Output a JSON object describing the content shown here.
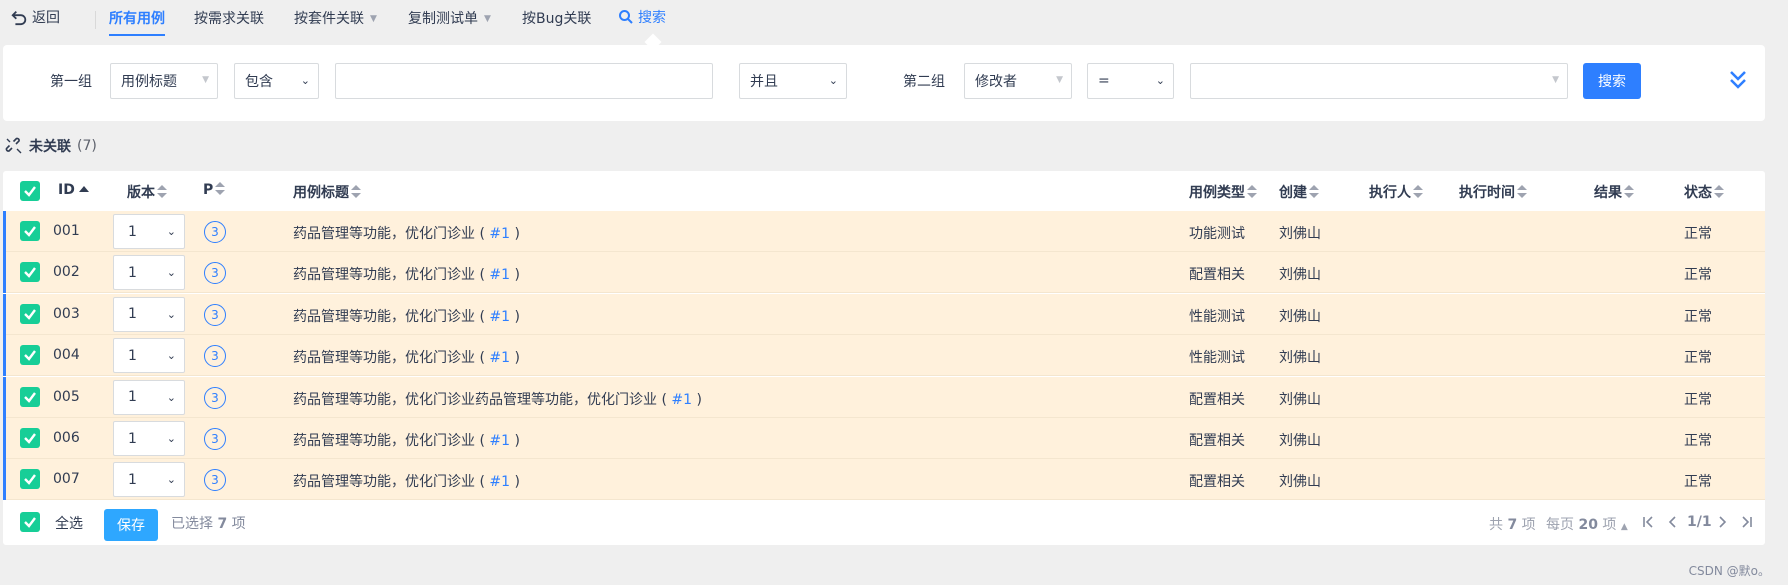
{
  "nav": {
    "back": "返回",
    "tabs": [
      {
        "label": "所有用例",
        "active": true
      },
      {
        "label": "按需求关联"
      },
      {
        "label": "按套件关联"
      },
      {
        "label": "复制测试单"
      },
      {
        "label": "按Bug关联"
      }
    ],
    "search": "搜索"
  },
  "search_panel": {
    "group1_label": "第一组",
    "group1_field": "用例标题",
    "group1_operator": "包含",
    "group1_value": "",
    "andor": "并且",
    "group2_label": "第二组",
    "group2_field": "修改者",
    "group2_operator": "=",
    "group2_value": "",
    "search_button": "搜索"
  },
  "section": {
    "title": "未关联",
    "count": "(7)"
  },
  "table": {
    "headers": {
      "id": "ID",
      "version": "版本",
      "pri": "P",
      "title": "用例标题",
      "type": "用例类型",
      "creator": "创建",
      "executor": "执行人",
      "exec_time": "执行时间",
      "result": "结果",
      "status": "状态"
    },
    "rows": [
      {
        "id": "001",
        "version": "1",
        "pri": "3",
        "title": "药品管理等功能，优化门诊业 (",
        "link": "#1",
        "close": ")",
        "type": "功能测试",
        "creator": "刘佛山",
        "status": "正常"
      },
      {
        "id": "002",
        "version": "1",
        "pri": "3",
        "title": "药品管理等功能，优化门诊业 (",
        "link": "#1",
        "close": ")",
        "type": "配置相关",
        "creator": "刘佛山",
        "status": "正常"
      },
      {
        "id": "003",
        "version": "1",
        "pri": "3",
        "title": "药品管理等功能，优化门诊业 (",
        "link": "#1",
        "close": ")",
        "type": "性能测试",
        "creator": "刘佛山",
        "status": "正常"
      },
      {
        "id": "004",
        "version": "1",
        "pri": "3",
        "title": "药品管理等功能，优化门诊业 (",
        "link": "#1",
        "close": ")",
        "type": "性能测试",
        "creator": "刘佛山",
        "status": "正常"
      },
      {
        "id": "005",
        "version": "1",
        "pri": "3",
        "title": "药品管理等功能，优化门诊业药品管理等功能，优化门诊业 (",
        "link": "#1",
        "close": ")",
        "type": "配置相关",
        "creator": "刘佛山",
        "status": "正常"
      },
      {
        "id": "006",
        "version": "1",
        "pri": "3",
        "title": "药品管理等功能，优化门诊业 (",
        "link": "#1",
        "close": ")",
        "type": "配置相关",
        "creator": "刘佛山",
        "status": "正常"
      },
      {
        "id": "007",
        "version": "1",
        "pri": "3",
        "title": "药品管理等功能，优化门诊业 (",
        "link": "#1",
        "close": ")",
        "type": "配置相关",
        "creator": "刘佛山",
        "status": "正常"
      }
    ]
  },
  "footer": {
    "select_all": "全选",
    "save": "保存",
    "selected_prefix": "已选择",
    "selected_count": "7",
    "selected_suffix": "项",
    "total_prefix": "共",
    "total": "7",
    "total_suffix": "项",
    "per_page_prefix": "每页",
    "per_page": "20",
    "per_page_suffix": "项",
    "page": "1/1"
  },
  "watermark": "CSDN @默o。",
  "colors": {
    "accent": "#2e7fff",
    "checkbox": "#17ce97",
    "row_selected": "#fff1dc",
    "save_button": "#2ea7ff"
  }
}
